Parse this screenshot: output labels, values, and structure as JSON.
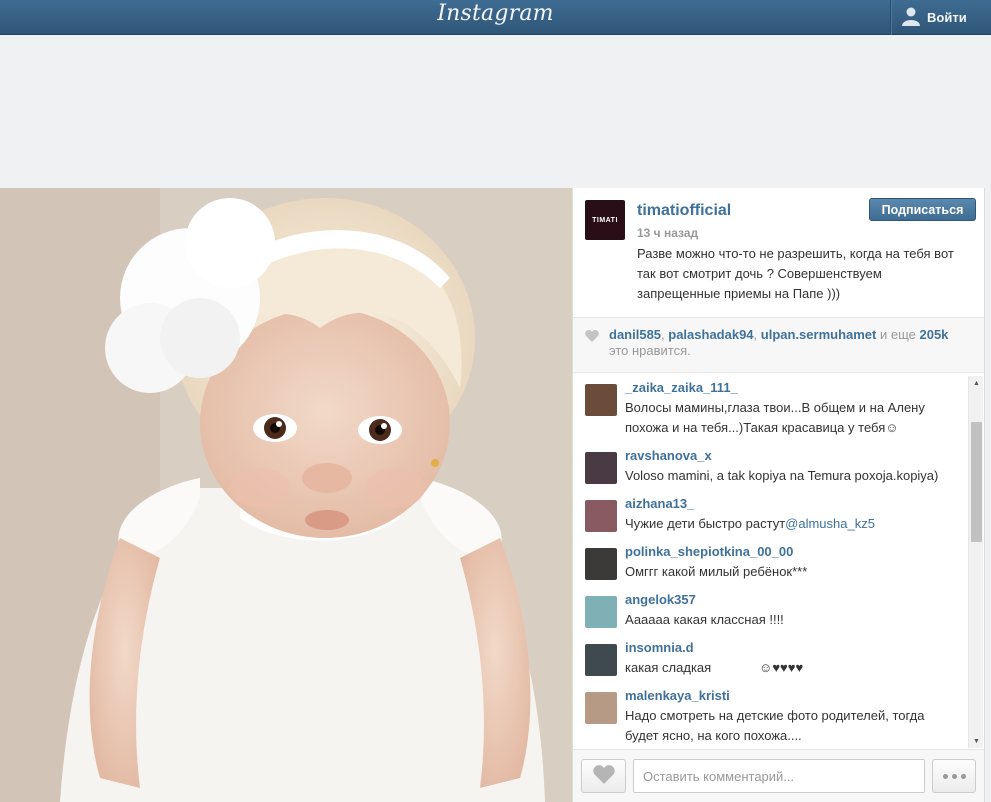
{
  "topbar": {
    "logo": "Instagram",
    "login_label": "Войти"
  },
  "post": {
    "username": "timatiofficial",
    "avatar_text": "TIMATI",
    "time_ago": "13 ч назад",
    "caption": "Разве можно что-то не разрешить, когда на тебя вот так вот смотрит дочь ? Совершенствуем запрещенные приемы на Папе )))",
    "follow_label": "Подписаться"
  },
  "likes": {
    "users": [
      "danil585",
      "palashadak94",
      "ulpan.sermuhamet"
    ],
    "sep": ", ",
    "more_prefix": " и еще ",
    "count": "205k",
    "suffix": "это нравится."
  },
  "comments": [
    {
      "user": "_zaika_zaika_111_",
      "text": "Волосы мамины,глаза твои...В общем и на Алену похожа и на тебя...)Такая красавица у тебя☺",
      "avatar_color": "#6b4b3a"
    },
    {
      "user": "ravshanova_x",
      "text": "Voloso mamini, a tak kopiya na Temura poxoja.kopiya)",
      "avatar_color": "#4a3a44"
    },
    {
      "user": "aizhana13_",
      "text": "Чужие дети быстро растут",
      "mention": "@almusha_kz5",
      "avatar_color": "#8a5a63"
    },
    {
      "user": "polinka_shepiotkina_00_00",
      "text": "Омггг какой милый ребёнок***",
      "avatar_color": "#3b3a38"
    },
    {
      "user": "angelok357",
      "text": "Аааааа какая классная !!!!",
      "avatar_color": "#7fb0b5"
    },
    {
      "user": "insomnia.d",
      "text": "какая сладкаяᅠᅠᅠᅠ☺♥♥♥♥",
      "avatar_color": "#3e4a4d"
    },
    {
      "user": "malenkaya_kristi",
      "text": "Надо смотреть на детские фото родителей, тогда будет ясно, на кого похожа....",
      "avatar_color": "#b79a86"
    }
  ],
  "comment_box": {
    "placeholder": "Оставить комментарий..."
  },
  "icons": {
    "user": "user-icon",
    "heart": "heart-icon",
    "more": "more-dots-icon"
  },
  "colors": {
    "link": "#3f729b",
    "topbar": "#3f6c93"
  }
}
